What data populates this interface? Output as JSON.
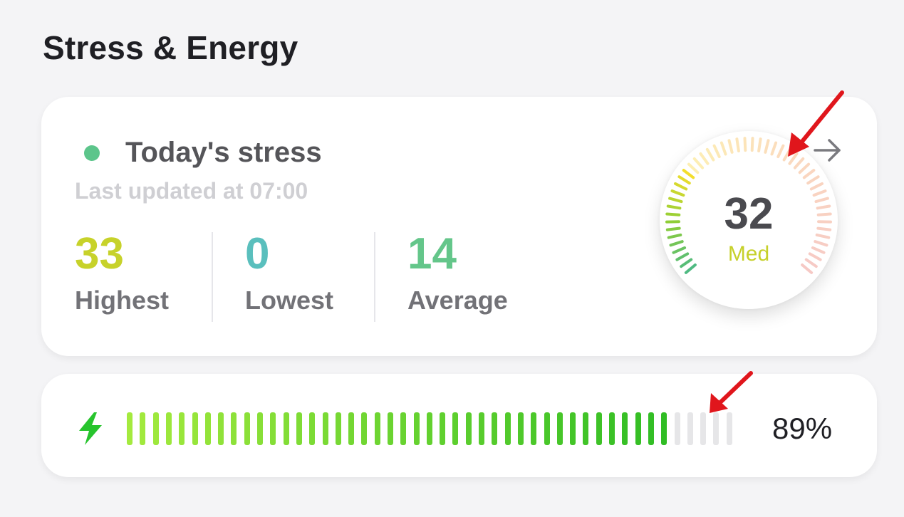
{
  "section": {
    "title": "Stress & Energy"
  },
  "stress": {
    "title": "Today's stress",
    "updated": "Last updated at 07:00",
    "status_color": "#5cc58b",
    "stats": [
      {
        "value": "33",
        "label": "Highest",
        "color": "#c7d22a"
      },
      {
        "value": "0",
        "label": "Lowest",
        "color": "#5abfbd"
      },
      {
        "value": "14",
        "label": "Average",
        "color": "#64c68a"
      }
    ],
    "gauge": {
      "value": "32",
      "level": "Med",
      "level_color": "#c6d02a",
      "fill_fraction": 0.32
    },
    "arrow_icon": "arrow-right-icon"
  },
  "energy": {
    "icon": "lightning-bolt-icon",
    "icon_color": "#27c42d",
    "percent": "89%",
    "level": 0.89,
    "segments_total": 47,
    "segments_filled": 42,
    "fill_start_color": "#a4ea3e",
    "fill_end_color": "#30bd24",
    "empty_color": "#e6e6e8"
  },
  "annotations": {
    "color": "#e0161c"
  }
}
